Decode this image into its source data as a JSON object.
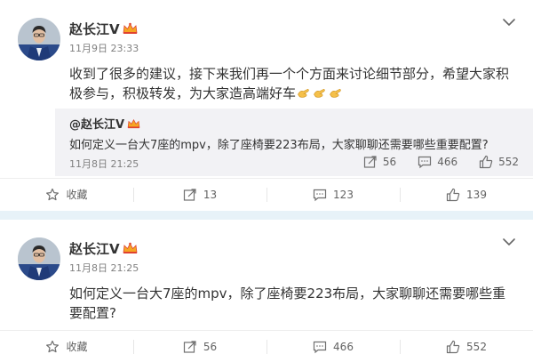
{
  "post1": {
    "author": "赵长江V",
    "meta": "11月9日 23:33",
    "content": "收到了很多的建议，接下来我们再一个个方面来讨论细节部分，希望大家积极参与，积极转发，为大家造高端好车",
    "emoji": [
      "clapping-hands-icon",
      "clapping-hands-icon",
      "clapping-hands-icon"
    ],
    "repost": {
      "author": "@赵长江V",
      "text": "如何定义一台大7座的mpv，除了座椅要223布局，大家聊聊还需要哪些重要配置?",
      "meta": "11月8日 21:25",
      "shares": "56",
      "comments": "466",
      "likes": "552"
    },
    "actions": {
      "favorite": "收藏",
      "share": "13",
      "comment": "123",
      "like": "139"
    }
  },
  "post2": {
    "author": "赵长江V",
    "meta": "11月8日 21:25",
    "content": "如何定义一台大7座的mpv，除了座椅要223布局，大家聊聊还需要哪些重要配置?",
    "actions": {
      "favorite": "收藏",
      "share": "56",
      "comment": "466",
      "like": "552"
    }
  },
  "colors": {
    "verified_badge": "#f78c00",
    "background_band": "#e7f2f8",
    "repost_bg": "#f2f2f5",
    "meta_text": "#808080"
  }
}
